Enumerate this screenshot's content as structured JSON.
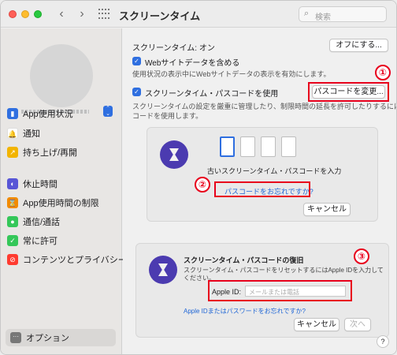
{
  "window": {
    "title": "スクリーンタイム"
  },
  "toolbar": {
    "back": "‹",
    "forward": "›",
    "search_placeholder": "検索"
  },
  "sidebar": {
    "items": [
      {
        "label": "App使用状況",
        "icon": "chart-bars-icon",
        "color": "#2f6fe0",
        "glyph": "▮"
      },
      {
        "label": "通知",
        "icon": "bell-icon",
        "color": "#ffffff",
        "glyph": "🔔"
      },
      {
        "label": "持ち上げ/再開",
        "icon": "pickup-icon",
        "color": "#f2b400",
        "glyph": "↗"
      },
      {
        "label": "休止時間",
        "icon": "downtime-icon",
        "color": "#5856d6",
        "glyph": "◐"
      },
      {
        "label": "App使用時間の制限",
        "icon": "hourglass-icon",
        "color": "#f28b00",
        "glyph": "⌛"
      },
      {
        "label": "通信/通話",
        "icon": "contacts-icon",
        "color": "#34c759",
        "glyph": "●"
      },
      {
        "label": "常に許可",
        "icon": "checkmark-icon",
        "color": "#34c759",
        "glyph": "✓"
      },
      {
        "label": "コンテンツとプライバシー",
        "icon": "restriction-icon",
        "color": "#ff3b30",
        "glyph": "⊘"
      }
    ],
    "options_label": "オプション"
  },
  "main": {
    "status_label": "スクリーンタイム: オン",
    "turn_off_button": "オフにする...",
    "web_checkbox_label": "Webサイトデータを含める",
    "web_desc": "使用状況の表示中にWebサイトデータの表示を有効にします。",
    "passcode_checkbox_label": "スクリーンタイム・パスコードを使用",
    "change_passcode_button": "パスコードを変更...",
    "passcode_desc_1": "スクリーンタイムの設定を厳重に管理したり、制限時間の延長を許可したりするにはパス",
    "passcode_desc_2": "コードを使用します。"
  },
  "passcode_dialog": {
    "prompt": "古いスクリーンタイム・パスコードを入力",
    "forgot_link": "パスコードをお忘れですか?",
    "cancel_button": "キャンセル"
  },
  "recovery_dialog": {
    "title": "スクリーンタイム・パスコードの復旧",
    "desc_1": "スクリーンタイム・パスコードをリセットするにはApple IDを入力して",
    "desc_2": "ください。",
    "appleid_label": "Apple ID:",
    "appleid_placeholder": "メールまたは電話",
    "forgot_link": "Apple IDまたはパスワードをお忘れですか?",
    "cancel_button": "キャンセル",
    "next_button": "次へ"
  },
  "annotations": {
    "one": "①",
    "two": "②",
    "three": "③"
  },
  "help": "?"
}
